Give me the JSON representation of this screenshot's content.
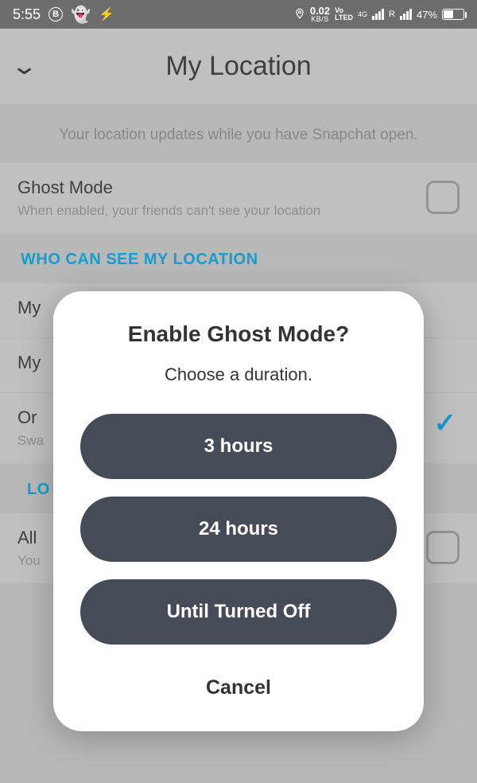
{
  "statusbar": {
    "time": "5:55",
    "speed_top": "0.02",
    "speed_bot": "KB/S",
    "volte_top": "Vo",
    "volte_bot": "LTED",
    "g4": "4G",
    "r": "R",
    "battery": "47%"
  },
  "header": {
    "title": "My Location"
  },
  "banner": "Your location updates while you have Snapchat open.",
  "ghost": {
    "title": "Ghost Mode",
    "sub": "When enabled, your friends can't see your location"
  },
  "section1": "WHO CAN SEE MY LOCATION",
  "rows": {
    "r1": "My",
    "r2": "My",
    "r3_title": "Or",
    "r3_sub": "Swa"
  },
  "section2": "LO",
  "rows2": {
    "r1_title": "All",
    "r1_sub": "You"
  },
  "modal": {
    "title": "Enable Ghost Mode?",
    "sub": "Choose a duration.",
    "opt1": "3 hours",
    "opt2": "24 hours",
    "opt3": "Until Turned Off",
    "cancel": "Cancel"
  }
}
